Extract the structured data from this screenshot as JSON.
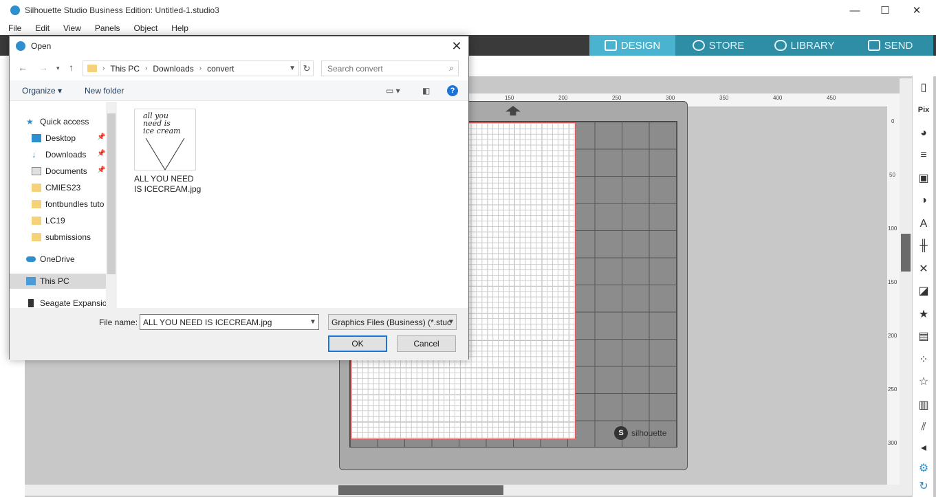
{
  "window": {
    "title": "Silhouette Studio Business Edition: Untitled-1.studio3",
    "controls": [
      "—",
      "☐",
      "✕"
    ]
  },
  "menu": [
    "File",
    "Edit",
    "View",
    "Panels",
    "Object",
    "Help"
  ],
  "nav_tabs": [
    {
      "label": "DESIGN",
      "active": true
    },
    {
      "label": "STORE",
      "active": false
    },
    {
      "label": "LIBRARY",
      "active": false
    },
    {
      "label": "SEND",
      "active": false
    }
  ],
  "ruler_top": [
    "150",
    "200",
    "250",
    "300",
    "350",
    "400",
    "450"
  ],
  "ruler_left": [
    "0",
    "50",
    "100",
    "150",
    "200",
    "250",
    "300"
  ],
  "mat_brand": "silhouette",
  "mat_brand_mark": "S",
  "dialog": {
    "title": "Open",
    "close": "✕",
    "breadcrumb": [
      "This PC",
      "Downloads",
      "convert"
    ],
    "search_placeholder": "Search convert",
    "organize_label": "Organize ▾",
    "new_folder_label": "New folder",
    "help_label": "?",
    "nav_items": [
      {
        "label": "Quick access",
        "icon": "star-icon"
      },
      {
        "label": "Desktop",
        "icon": "desktop-icon",
        "pinned": true
      },
      {
        "label": "Downloads",
        "icon": "download-icon",
        "pinned": true
      },
      {
        "label": "Documents",
        "icon": "documents-icon",
        "pinned": true
      },
      {
        "label": "CMIES23",
        "icon": "folder-icon"
      },
      {
        "label": "fontbundles tuto",
        "icon": "folder-icon"
      },
      {
        "label": "LC19",
        "icon": "folder-icon"
      },
      {
        "label": "submissions",
        "icon": "folder-icon"
      },
      {
        "label": "OneDrive",
        "icon": "cloud-icon"
      },
      {
        "label": "This PC",
        "icon": "computer-icon",
        "selected": true
      },
      {
        "label": "Seagate Expansion",
        "icon": "drive-icon"
      }
    ],
    "file": {
      "name": "ALL YOU NEED IS ICECREAM.jpg",
      "thumb_text": [
        "all you",
        "need is",
        "ice cream"
      ]
    },
    "file_name_label": "File name:",
    "file_name_value": "ALL YOU NEED IS ICECREAM.jpg",
    "file_type_value": "Graphics Files (Business) (*.stuc",
    "ok_label": "OK",
    "cancel_label": "Cancel"
  },
  "colors": {
    "nav_bg": "#2d8ea6",
    "nav_active": "#4ab3d0",
    "accent_blue": "#1c74d9"
  }
}
